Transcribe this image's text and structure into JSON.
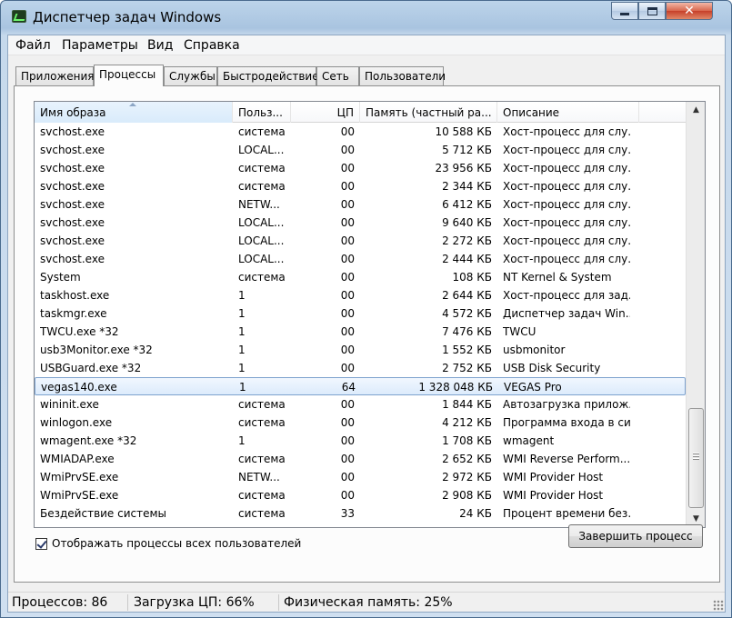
{
  "window": {
    "title": "Диспетчер задач Windows"
  },
  "menu": [
    "Файл",
    "Параметры",
    "Вид",
    "Справка"
  ],
  "tabs": [
    "Приложения",
    "Процессы",
    "Службы",
    "Быстродействие",
    "Сеть",
    "Пользователи"
  ],
  "active_tab": "Процессы",
  "columns": [
    "Имя образа",
    "Польз...",
    "ЦП",
    "Память (частный ра...",
    "Описание"
  ],
  "rows": [
    {
      "name": "svchost.exe",
      "user": "система",
      "cpu": "00",
      "mem": "10 588 КБ",
      "desc": "Хост-процесс для слу..."
    },
    {
      "name": "svchost.exe",
      "user": "LOCAL...",
      "cpu": "00",
      "mem": "5 712 КБ",
      "desc": "Хост-процесс для слу..."
    },
    {
      "name": "svchost.exe",
      "user": "система",
      "cpu": "00",
      "mem": "23 956 КБ",
      "desc": "Хост-процесс для слу..."
    },
    {
      "name": "svchost.exe",
      "user": "система",
      "cpu": "00",
      "mem": "2 344 КБ",
      "desc": "Хост-процесс для слу..."
    },
    {
      "name": "svchost.exe",
      "user": "NETW...",
      "cpu": "00",
      "mem": "6 412 КБ",
      "desc": "Хост-процесс для слу..."
    },
    {
      "name": "svchost.exe",
      "user": "LOCAL...",
      "cpu": "00",
      "mem": "9 640 КБ",
      "desc": "Хост-процесс для слу..."
    },
    {
      "name": "svchost.exe",
      "user": "LOCAL...",
      "cpu": "00",
      "mem": "2 272 КБ",
      "desc": "Хост-процесс для слу..."
    },
    {
      "name": "svchost.exe",
      "user": "LOCAL...",
      "cpu": "00",
      "mem": "2 444 КБ",
      "desc": "Хост-процесс для слу..."
    },
    {
      "name": "System",
      "user": "система",
      "cpu": "00",
      "mem": "108 КБ",
      "desc": "NT Kernel & System"
    },
    {
      "name": "taskhost.exe",
      "user": "1",
      "cpu": "00",
      "mem": "2 644 КБ",
      "desc": "Хост-процесс для зад..."
    },
    {
      "name": "taskmgr.exe",
      "user": "1",
      "cpu": "00",
      "mem": "4 572 КБ",
      "desc": "Диспетчер задач Win..."
    },
    {
      "name": "TWCU.exe *32",
      "user": "1",
      "cpu": "00",
      "mem": "7 476 КБ",
      "desc": "TWCU"
    },
    {
      "name": "usb3Monitor.exe *32",
      "user": "1",
      "cpu": "00",
      "mem": "1 552 КБ",
      "desc": "usbmonitor"
    },
    {
      "name": "USBGuard.exe *32",
      "user": "1",
      "cpu": "00",
      "mem": "2 752 КБ",
      "desc": "USB Disk Security"
    },
    {
      "name": "vegas140.exe",
      "user": "1",
      "cpu": "64",
      "mem": "1 328 048 КБ",
      "desc": "VEGAS Pro",
      "selected": true
    },
    {
      "name": "wininit.exe",
      "user": "система",
      "cpu": "00",
      "mem": "1 844 КБ",
      "desc": "Автозагрузка прилож..."
    },
    {
      "name": "winlogon.exe",
      "user": "система",
      "cpu": "00",
      "mem": "4 212 КБ",
      "desc": "Программа входа в си..."
    },
    {
      "name": "wmagent.exe *32",
      "user": "1",
      "cpu": "00",
      "mem": "1 708 КБ",
      "desc": "wmagent"
    },
    {
      "name": "WMIADAP.exe",
      "user": "система",
      "cpu": "00",
      "mem": "2 652 КБ",
      "desc": "WMI Reverse Perform..."
    },
    {
      "name": "WmiPrvSE.exe",
      "user": "NETW...",
      "cpu": "00",
      "mem": "2 972 КБ",
      "desc": "WMI Provider Host"
    },
    {
      "name": "WmiPrvSE.exe",
      "user": "система",
      "cpu": "00",
      "mem": "2 908 КБ",
      "desc": "WMI Provider Host"
    },
    {
      "name": "Бездействие системы",
      "user": "система",
      "cpu": "33",
      "mem": "24 КБ",
      "desc": "Процент времени без..."
    }
  ],
  "show_all_users": {
    "label": "Отображать процессы всех пользователей",
    "checked": true
  },
  "end_process_label": "Завершить процесс",
  "status": {
    "processes": "Процессов: 86",
    "cpu": "Загрузка ЦП: 66%",
    "memory": "Физическая память: 25%"
  }
}
